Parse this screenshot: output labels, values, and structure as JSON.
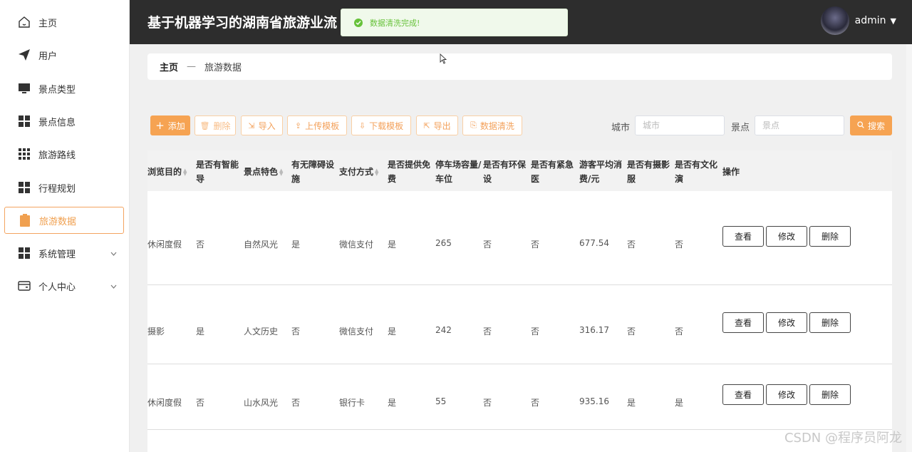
{
  "sidebar": {
    "items": [
      {
        "label": "主页",
        "icon": "home-icon"
      },
      {
        "label": "用户",
        "icon": "send-icon"
      },
      {
        "label": "景点类型",
        "icon": "monitor-icon"
      },
      {
        "label": "景点信息",
        "icon": "grid-icon"
      },
      {
        "label": "旅游路线",
        "icon": "grid-nine-icon"
      },
      {
        "label": "行程规划",
        "icon": "grid-icon"
      },
      {
        "label": "旅游数据",
        "icon": "clipboard-icon",
        "active": true
      },
      {
        "label": "系统管理",
        "icon": "grid-icon",
        "expandable": true
      },
      {
        "label": "个人中心",
        "icon": "wallet-icon",
        "expandable": true
      }
    ]
  },
  "header": {
    "title": "基于机器学习的湖南省旅游业流",
    "username": "admin"
  },
  "toast": {
    "message": "数据清洗完成!"
  },
  "breadcrumb": {
    "home": "主页",
    "separator": "—",
    "current": "旅游数据"
  },
  "toolbar": {
    "add": "添加",
    "delete": "删除",
    "import": "导入",
    "upload_template": "上传模板",
    "download_template": "下载模板",
    "export": "导出",
    "clean": "数据清洗",
    "city_label": "城市",
    "city_placeholder": "城市",
    "spot_label": "景点",
    "spot_placeholder": "景点",
    "search": "搜索"
  },
  "table": {
    "headers": [
      "浏览目的",
      "是否有智能导览",
      "景点特色",
      "有无障碍设施",
      "支付方式",
      "是否提供免费WIFI",
      "停车场容量/车位",
      "是否有环保设施",
      "是否有紧急医疗站",
      "游客平均消费/元",
      "是否有摄影服务",
      "是否有文化演出",
      "操作"
    ],
    "header_shown": [
      "浏览目的",
      "是否有智能导\n览",
      "景点特色",
      "有无障碍设\n施",
      "支付方式",
      "是否提供免费\nWIFI",
      "停车场容量/\n车位",
      "是否有环保设\n施",
      "是否有紧急医\n疗站",
      "游客平均消\n费/元",
      "是否有摄影服\n务",
      "是否有文化演\n出",
      "操作"
    ],
    "rows": [
      [
        "休闲度假",
        "否",
        "自然风光",
        "是",
        "微信支付",
        "是",
        "265",
        "否",
        "否",
        "677.54",
        "否",
        "否"
      ],
      [
        "摄影",
        "是",
        "人文历史",
        "否",
        "微信支付",
        "是",
        "242",
        "否",
        "否",
        "316.17",
        "否",
        "否"
      ],
      [
        "休闲度假",
        "否",
        "山水风光",
        "否",
        "银行卡",
        "是",
        "55",
        "否",
        "否",
        "935.16",
        "是",
        "是"
      ]
    ],
    "actions": {
      "view": "查看",
      "edit": "修改",
      "delete": "删除"
    }
  },
  "watermark": "CSDN @程序员阿龙"
}
